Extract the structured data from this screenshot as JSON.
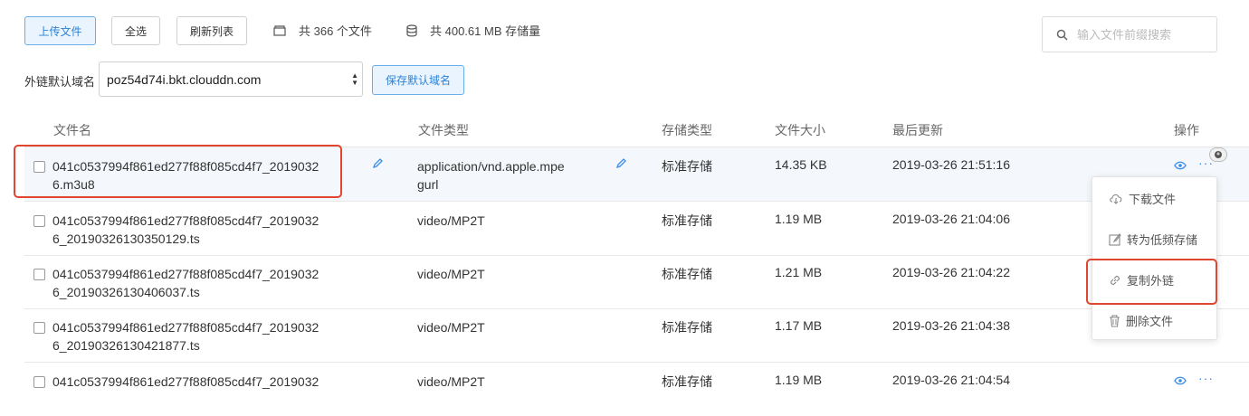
{
  "toolbar": {
    "upload_label": "上传文件",
    "select_all_label": "全选",
    "refresh_label": "刷新列表",
    "file_count_text": "共 366 个文件",
    "storage_text": "共 400.61 MB 存储量"
  },
  "search": {
    "placeholder": "输入文件前缀搜索"
  },
  "domain": {
    "label": "外链默认域名",
    "value": "poz54d74i.bkt.clouddn.com",
    "save_label": "保存默认域名"
  },
  "table": {
    "headers": {
      "name": "文件名",
      "type": "文件类型",
      "storage": "存储类型",
      "size": "文件大小",
      "updated": "最后更新",
      "actions": "操作"
    },
    "rows": [
      {
        "name_line1": "041c0537994f861ed277f88f085cd4f7_2019032",
        "name_line2": "6.m3u8",
        "type_line1": "application/vnd.apple.mpe",
        "type_line2": "gurl",
        "storage": "标准存储",
        "size": "14.35 KB",
        "updated": "2019-03-26 21:51:16"
      },
      {
        "name_line1": "041c0537994f861ed277f88f085cd4f7_2019032",
        "name_line2": "6_20190326130350129.ts",
        "type_line1": "video/MP2T",
        "type_line2": "",
        "storage": "标准存储",
        "size": "1.19 MB",
        "updated": "2019-03-26 21:04:06"
      },
      {
        "name_line1": "041c0537994f861ed277f88f085cd4f7_2019032",
        "name_line2": "6_20190326130406037.ts",
        "type_line1": "video/MP2T",
        "type_line2": "",
        "storage": "标准存储",
        "size": "1.21 MB",
        "updated": "2019-03-26 21:04:22"
      },
      {
        "name_line1": "041c0537994f861ed277f88f085cd4f7_2019032",
        "name_line2": "6_20190326130421877.ts",
        "type_line1": "video/MP2T",
        "type_line2": "",
        "storage": "标准存储",
        "size": "1.17 MB",
        "updated": "2019-03-26 21:04:38"
      },
      {
        "name_line1": "041c0537994f861ed277f88f085cd4f7_2019032",
        "name_line2": "",
        "type_line1": "video/MP2T",
        "type_line2": "",
        "storage": "标准存储",
        "size": "1.19 MB",
        "updated": "2019-03-26 21:04:54"
      }
    ]
  },
  "action_menu": {
    "items": [
      {
        "label": "下载文件",
        "icon": "cloud-download-icon"
      },
      {
        "label": "转为低频存储",
        "icon": "edit-icon"
      },
      {
        "label": "复制外链",
        "icon": "link-icon"
      },
      {
        "label": "删除文件",
        "icon": "trash-icon"
      }
    ]
  },
  "colors": {
    "accent": "#2d82d6",
    "highlight_border": "#e0452f",
    "row_highlight": "#f4f8fc"
  }
}
